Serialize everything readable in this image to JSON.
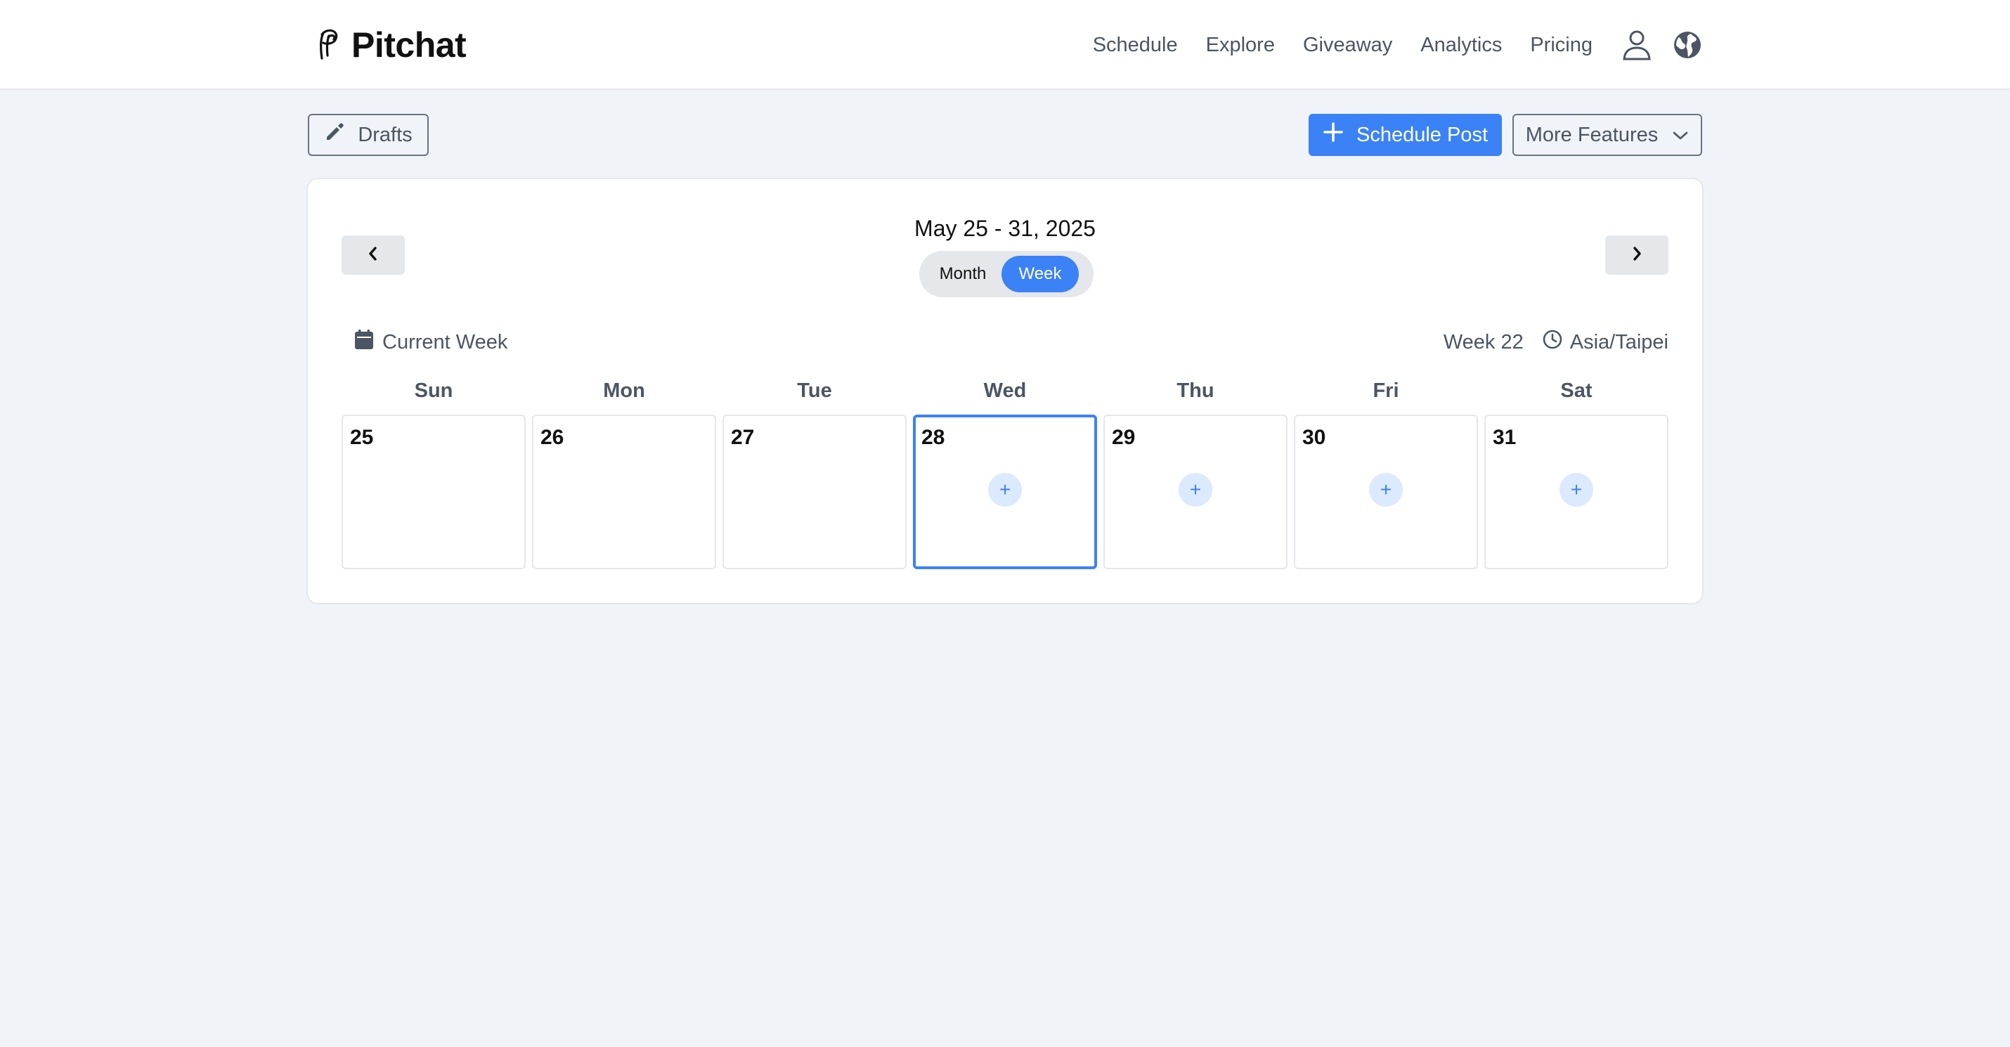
{
  "header": {
    "brand": "Pitchat",
    "nav": [
      "Schedule",
      "Explore",
      "Giveaway",
      "Analytics",
      "Pricing"
    ],
    "icons": [
      "user-icon",
      "globe-icon"
    ]
  },
  "toolbar": {
    "drafts_label": "Drafts",
    "schedule_label": "Schedule Post",
    "more_label": "More Features"
  },
  "calendar": {
    "range_title": "May 25 - 31, 2025",
    "views": {
      "month": "Month",
      "week": "Week",
      "selected": "Week"
    },
    "current_label": "Current Week",
    "week_label": "Week 22",
    "timezone": "Asia/Taipei",
    "weekdays": [
      "Sun",
      "Mon",
      "Tue",
      "Wed",
      "Thu",
      "Fri",
      "Sat"
    ],
    "days": [
      {
        "num": "25",
        "add": false,
        "today": false
      },
      {
        "num": "26",
        "add": false,
        "today": false
      },
      {
        "num": "27",
        "add": false,
        "today": false
      },
      {
        "num": "28",
        "add": true,
        "today": true
      },
      {
        "num": "29",
        "add": true,
        "today": false
      },
      {
        "num": "30",
        "add": true,
        "today": false
      },
      {
        "num": "31",
        "add": true,
        "today": false
      }
    ],
    "add_symbol": "+"
  },
  "colors": {
    "accent": "#3b82f6",
    "background": "#f0f3f8",
    "add_bg": "#dbeafe"
  }
}
